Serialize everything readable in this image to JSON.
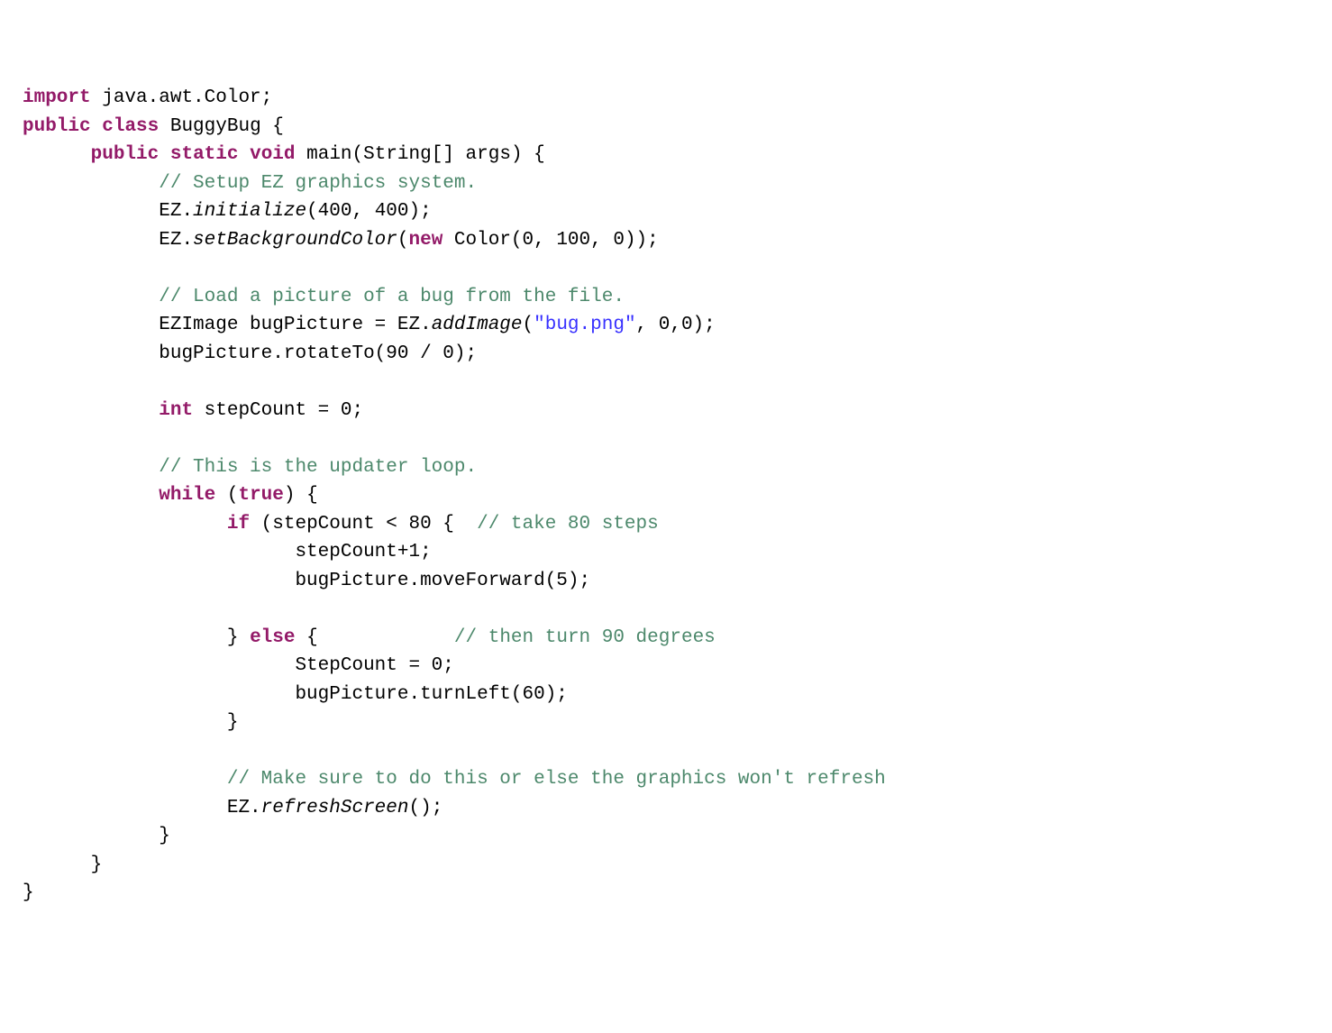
{
  "code": {
    "l01": {
      "kw1": "import",
      "t1": " java.awt.Color;"
    },
    "l02": {
      "kw1": "public",
      "kw2": "class",
      "t1": " BuggyBug {"
    },
    "l03": {
      "kw1": "public",
      "kw2": "static",
      "kw3": "void",
      "t1": " main(String[] args) {"
    },
    "l04": {
      "cm": "// Setup EZ graphics system."
    },
    "l05": {
      "t1": "EZ.",
      "it": "initialize",
      "t2": "(400, 400);"
    },
    "l06": {
      "t1": "EZ.",
      "it": "setBackgroundColor",
      "t2": "(",
      "kw": "new",
      "t3": " Color(0, 100, 0));"
    },
    "l07": {
      "cm": "// Load a picture of a bug from the file."
    },
    "l08": {
      "t1": "EZImage bugPicture = EZ.",
      "it": "addImage",
      "t2": "(",
      "str": "\"bug.png\"",
      "t3": ", 0,0);"
    },
    "l09": {
      "t1": "bugPicture.rotateTo(90 / 0);"
    },
    "l10": {
      "kw": "int",
      "t1": " stepCount = 0;"
    },
    "l11": {
      "cm": "// This is the updater loop."
    },
    "l12": {
      "kw1": "while",
      "t1": " (",
      "kw2": "true",
      "t2": ") {"
    },
    "l13": {
      "kw": "if",
      "t1": " (stepCount < 80 {  ",
      "cm": "// take 80 steps"
    },
    "l14": {
      "t1": "stepCount+1;"
    },
    "l15": {
      "t1": "bugPicture.moveForward(5);"
    },
    "l16": {
      "t1": "} ",
      "kw": "else",
      "t2": " {            ",
      "cm": "// then turn 90 degrees"
    },
    "l17": {
      "t1": "StepCount = 0;"
    },
    "l18": {
      "t1": "bugPicture.turnLeft(60);"
    },
    "l19": {
      "t1": "}"
    },
    "l20": {
      "cm": "// Make sure to do this or else the graphics won't refresh"
    },
    "l21": {
      "t1": "EZ.",
      "it": "refreshScreen",
      "t2": "();"
    },
    "l22": {
      "t1": "}"
    },
    "l23": {
      "t1": "}"
    },
    "l24": {
      "t1": "}"
    }
  }
}
